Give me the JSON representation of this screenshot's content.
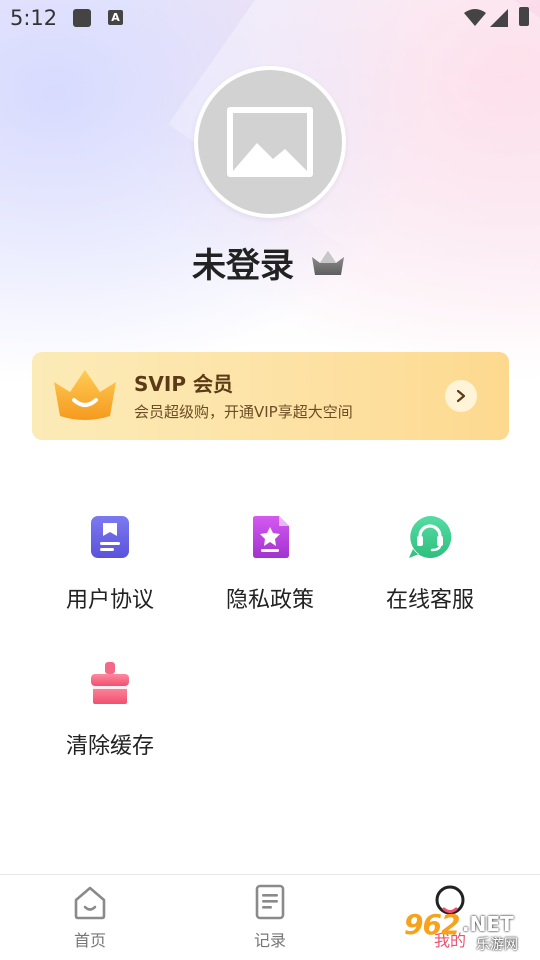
{
  "status_bar": {
    "time": "5:12",
    "notif_icon": "a-icon",
    "notif_letter": "A"
  },
  "profile": {
    "username": "未登录",
    "crown_icon": "crown-icon"
  },
  "svip": {
    "title": "SVIP 会员",
    "subtitle": "会员超级购，开通VIP享超大空间",
    "accent": "#fde1a3",
    "text_color": "#5b3b17"
  },
  "menu": {
    "items": [
      {
        "label": "用户协议",
        "icon": "bookmark-document-icon",
        "color": "#6a63e6"
      },
      {
        "label": "隐私政策",
        "icon": "star-document-icon",
        "color": "#b43ad8"
      },
      {
        "label": "在线客服",
        "icon": "headset-chat-icon",
        "color": "#3dcc8e"
      },
      {
        "label": "清除缓存",
        "icon": "broom-icon",
        "color": "#f46a86"
      }
    ]
  },
  "tabbar": {
    "items": [
      {
        "label": "首页",
        "icon": "home-icon"
      },
      {
        "label": "记录",
        "icon": "document-icon"
      },
      {
        "label": "我的",
        "icon": "profile-icon"
      }
    ]
  },
  "watermark": {
    "number": "962",
    "suffix": ".NET",
    "site": "乐游网"
  }
}
